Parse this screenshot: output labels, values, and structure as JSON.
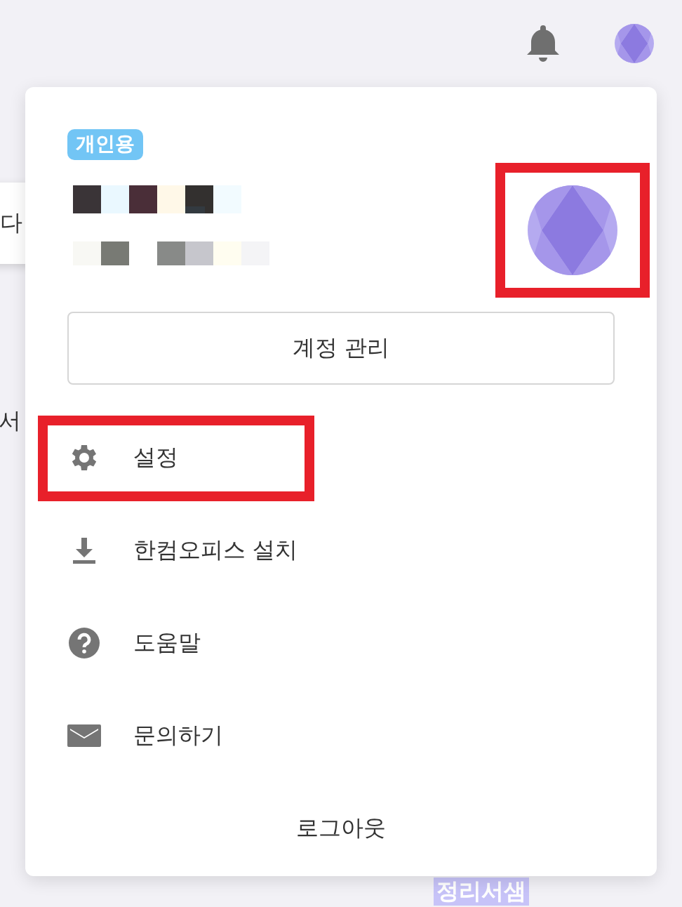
{
  "background": {
    "texts": [
      {
        "kind": "card",
        "text": "다"
      },
      {
        "kind": "plain",
        "text": "서"
      },
      {
        "kind": "highlight",
        "text": "정리서샘"
      }
    ]
  },
  "account_menu": {
    "badge": "개인용",
    "profile": {
      "avatar_marked": true
    },
    "account_button": "계정 관리",
    "items": [
      {
        "kind": "settings",
        "label": "설정",
        "marked": true
      },
      {
        "kind": "download",
        "label": "한컴오피스 설치",
        "marked": false
      },
      {
        "kind": "help",
        "label": "도움말",
        "marked": false
      },
      {
        "kind": "mail",
        "label": "문의하기",
        "marked": false
      }
    ],
    "logout": "로그아웃"
  }
}
